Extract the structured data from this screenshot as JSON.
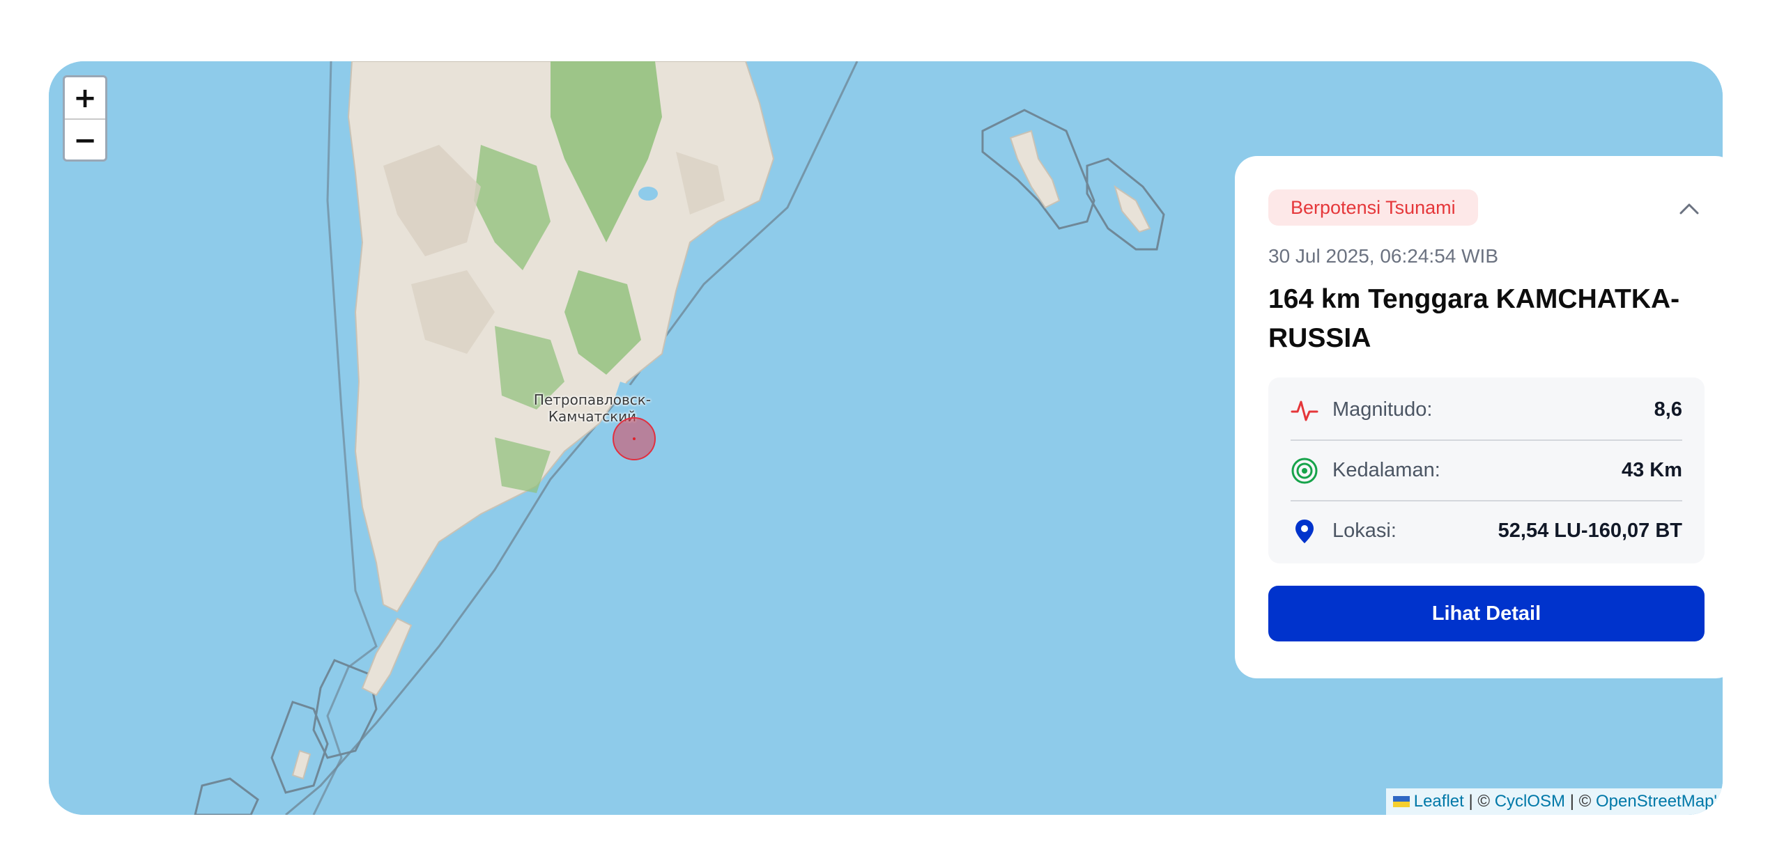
{
  "map": {
    "city_label_line1": "Петропавловск-",
    "city_label_line2": "Камчатский",
    "zoom_in": "+",
    "zoom_out": "−",
    "colors": {
      "sea": "#8ecbea",
      "land": "#e8e2d8",
      "forest": "#8fc07a",
      "marker": "#d8465a"
    }
  },
  "attribution": {
    "leaflet": "Leaflet",
    "sep1": " | © ",
    "cyclosm": "CyclOSM",
    "sep2": " | © ",
    "osm": "OpenStreetMap'"
  },
  "card": {
    "badge": "Berpotensi Tsunami",
    "datetime": "30 Jul 2025, 06:24:54 WIB",
    "title": "164 km Tenggara KAMCHATKA-RUSSIA",
    "rows": [
      {
        "icon": "pulse-icon",
        "label": "Magnitudo:",
        "value": "8,6"
      },
      {
        "icon": "target-icon",
        "label": "Kedalaman:",
        "value": "43 Km"
      },
      {
        "icon": "map-pin-icon",
        "label": "Lokasi:",
        "value": "52,54 LU-160,07 BT"
      }
    ],
    "button": "Lihat Detail"
  }
}
